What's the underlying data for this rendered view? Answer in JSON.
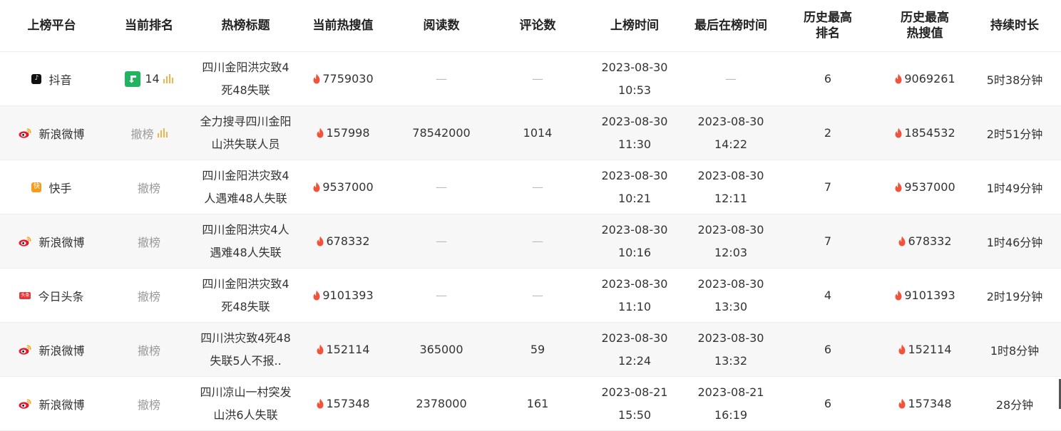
{
  "headers": [
    {
      "label": "上榜平台"
    },
    {
      "label": "当前排名"
    },
    {
      "label": "热榜标题"
    },
    {
      "label": "当前热搜值"
    },
    {
      "label": "阅读数"
    },
    {
      "label": "评论数"
    },
    {
      "label": "上榜时间"
    },
    {
      "label": "最后在榜时间"
    },
    {
      "label": "历史最高\n排名"
    },
    {
      "label": "历史最高\n热搜值"
    },
    {
      "label": "持续时长"
    }
  ],
  "rows": [
    {
      "platform": "抖音",
      "platform_icon": "douyin-icon",
      "rank": "14",
      "rank_trend": "down-arrow-icon",
      "title": "四川金阳洪灾致4死48失联",
      "hot": "7759030",
      "reads": "—",
      "comments": "—",
      "start_date": "2023-08-30",
      "start_time": "10:53",
      "end_date": "—",
      "end_time": "",
      "hist_rank": "6",
      "hist_hot": "9069261",
      "duration": "5时38分钟"
    },
    {
      "platform": "新浪微博",
      "platform_icon": "weibo-icon",
      "rank": "撤榜",
      "title": "全力搜寻四川金阳山洪失联人员",
      "hot": "157998",
      "reads": "78542000",
      "comments": "1014",
      "start_date": "2023-08-30",
      "start_time": "11:30",
      "end_date": "2023-08-30",
      "end_time": "14:22",
      "hist_rank": "2",
      "hist_hot": "1854532",
      "duration": "2时51分钟"
    },
    {
      "platform": "快手",
      "platform_icon": "kuaishou-icon",
      "rank": "撤榜",
      "title": "四川金阳洪灾致4人遇难48人失联",
      "hot": "9537000",
      "reads": "—",
      "comments": "—",
      "start_date": "2023-08-30",
      "start_time": "10:21",
      "end_date": "2023-08-30",
      "end_time": "12:11",
      "hist_rank": "7",
      "hist_hot": "9537000",
      "duration": "1时49分钟"
    },
    {
      "platform": "新浪微博",
      "platform_icon": "weibo-icon",
      "rank": "撤榜",
      "title": "四川金阳洪灾4人遇难48人失联",
      "hot": "678332",
      "reads": "—",
      "comments": "—",
      "start_date": "2023-08-30",
      "start_time": "10:16",
      "end_date": "2023-08-30",
      "end_time": "12:03",
      "hist_rank": "7",
      "hist_hot": "678332",
      "duration": "1时46分钟"
    },
    {
      "platform": "今日头条",
      "platform_icon": "toutiao-icon",
      "rank": "撤榜",
      "title": "四川金阳洪灾致4死48失联",
      "hot": "9101393",
      "reads": "—",
      "comments": "—",
      "start_date": "2023-08-30",
      "start_time": "11:10",
      "end_date": "2023-08-30",
      "end_time": "13:30",
      "hist_rank": "4",
      "hist_hot": "9101393",
      "duration": "2时19分钟"
    },
    {
      "platform": "新浪微博",
      "platform_icon": "weibo-icon",
      "rank": "撤榜",
      "title": "四川洪灾致4死48失联5人不报..",
      "hot": "152114",
      "reads": "365000",
      "comments": "59",
      "start_date": "2023-08-30",
      "start_time": "12:24",
      "end_date": "2023-08-30",
      "end_time": "13:32",
      "hist_rank": "6",
      "hist_hot": "152114",
      "duration": "1时8分钟"
    },
    {
      "platform": "新浪微博",
      "platform_icon": "weibo-icon",
      "rank": "撤榜",
      "title": "四川凉山一村突发山洪6人失联",
      "hot": "157348",
      "reads": "2378000",
      "comments": "161",
      "start_date": "2023-08-21",
      "start_time": "15:50",
      "end_date": "2023-08-21",
      "end_time": "16:19",
      "hist_rank": "6",
      "hist_hot": "157348",
      "duration": "28分钟"
    }
  ],
  "platform_badges": {
    "douyin": "♪",
    "kuaishou": "快",
    "toutiao": "头条"
  },
  "colors": {
    "flame": "#f0533a",
    "trend_down": "#20b360",
    "bars": "#f0b44c",
    "muted": "#9a9a9a"
  }
}
